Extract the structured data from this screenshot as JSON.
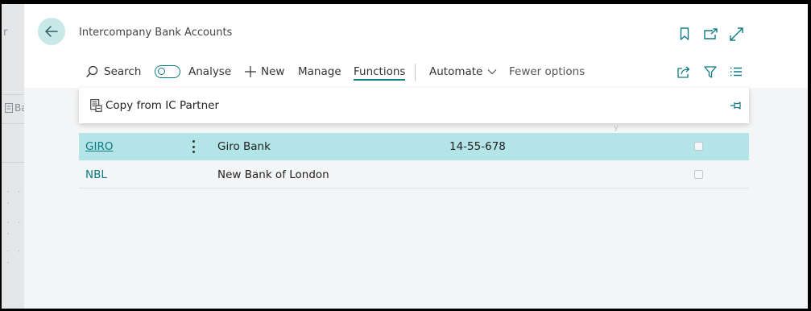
{
  "background": {
    "partial_label": "r",
    "partial_item": "Ba"
  },
  "header": {
    "title": "Intercompany Bank Accounts",
    "back_icon": "arrow-left-icon",
    "bookmark_icon": "bookmark-icon",
    "popout_icon": "open-in-new-window-icon",
    "expand_icon": "expand-icon"
  },
  "actionbar": {
    "search": "Search",
    "analyse": "Analyse",
    "new": "New",
    "manage": "Manage",
    "functions": "Functions",
    "automate": "Automate",
    "fewer_options": "Fewer options",
    "share_icon": "share-icon",
    "filter_icon": "filter-icon",
    "list_icon": "list-view-icon"
  },
  "functions_menu": {
    "items": [
      {
        "label": "Copy from IC Partner",
        "icon": "copy-document-icon"
      }
    ],
    "pin_icon": "pin-icon"
  },
  "table": {
    "rows": [
      {
        "code": "GIRO",
        "name": "Giro Bank",
        "account": "14-55-678",
        "selected": true,
        "checked": false
      },
      {
        "code": "NBL",
        "name": "New Bank of London",
        "account": "",
        "selected": false,
        "checked": false
      }
    ]
  },
  "colors": {
    "accent": "#0e7a80",
    "selected_row": "#b3e5e8",
    "back_button_bg": "#c9e8ea"
  }
}
